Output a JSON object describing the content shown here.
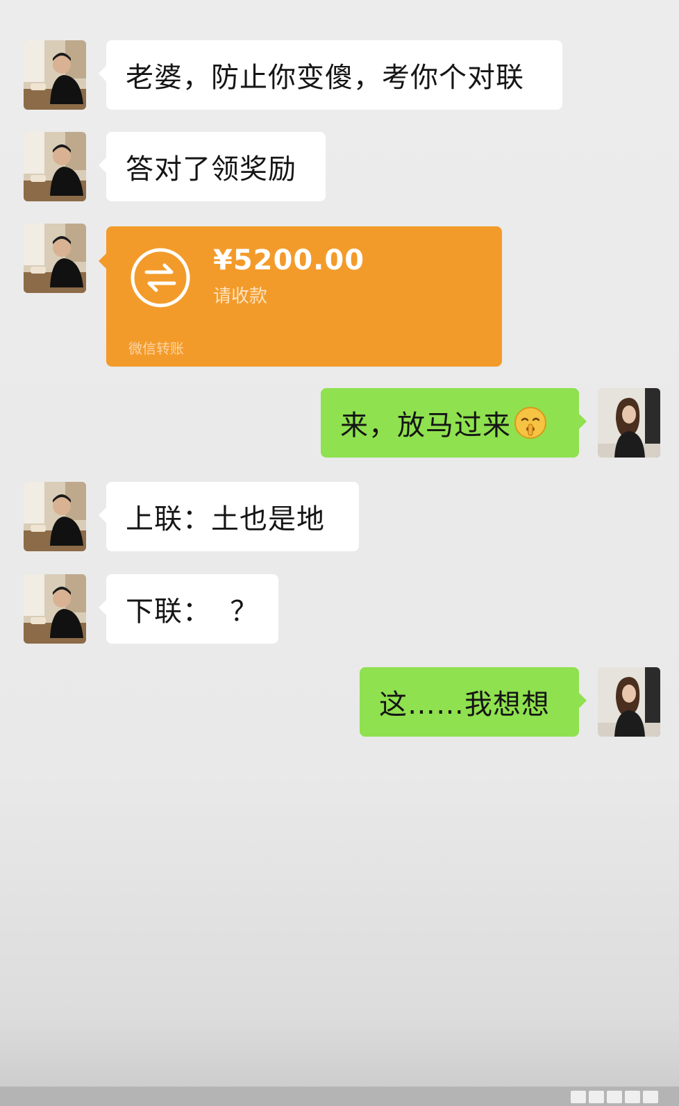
{
  "messages": [
    {
      "from": "him",
      "type": "text",
      "text": "老婆，防止你变傻，考你个对联"
    },
    {
      "from": "him",
      "type": "text",
      "text": "答对了领奖励"
    },
    {
      "from": "him",
      "type": "transfer",
      "amount": "¥5200.00",
      "subtitle": "请收款",
      "footer": "微信转账"
    },
    {
      "from": "her",
      "type": "text",
      "text": "来，放马过来",
      "emoji": "shushing-face-emoji"
    },
    {
      "from": "him",
      "type": "text",
      "text": "上联：土也是地"
    },
    {
      "from": "him",
      "type": "text",
      "text": "下联：  ？"
    },
    {
      "from": "her",
      "type": "text",
      "text": "这……我想想"
    }
  ],
  "colors": {
    "incoming_bubble": "#ffffff",
    "outgoing_bubble": "#8fe14f",
    "transfer_card": "#f39b2a",
    "background": "#ececec"
  },
  "icons": {
    "transfer": "transfer-arrows-icon",
    "avatar_him": "man-at-table-avatar",
    "avatar_her": "woman-portrait-avatar"
  }
}
